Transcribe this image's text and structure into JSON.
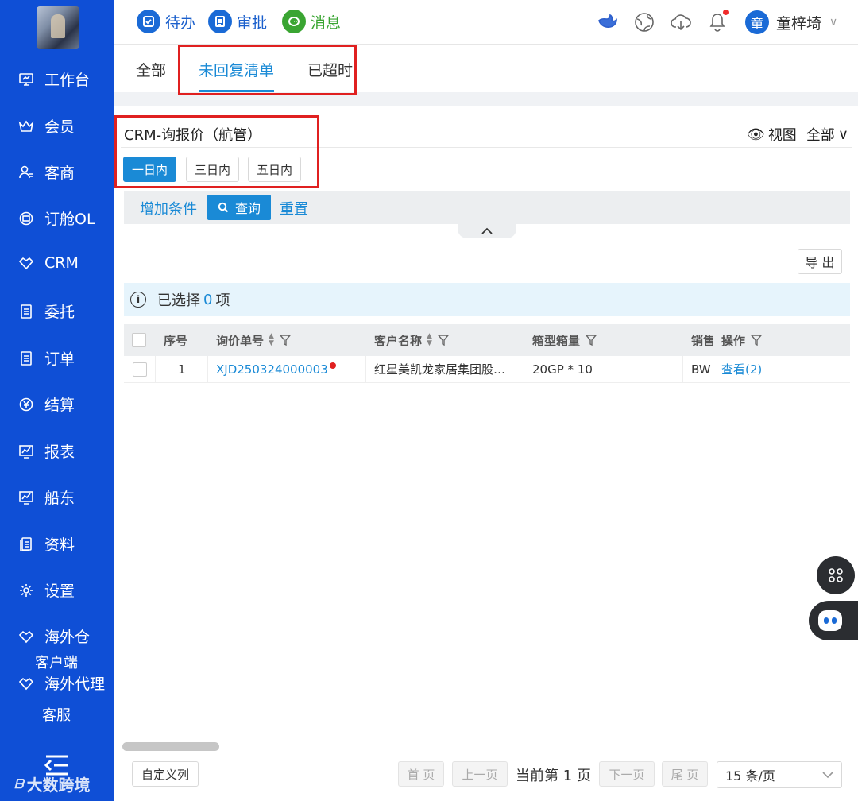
{
  "sidebar": {
    "items": [
      {
        "label": "工作台",
        "icon": "monitor-icon"
      },
      {
        "label": "会员",
        "icon": "crown-icon"
      },
      {
        "label": "客商",
        "icon": "user-group-icon"
      },
      {
        "label": "订舱OL",
        "icon": "booking-icon"
      },
      {
        "label": "CRM",
        "icon": "handshake-icon"
      },
      {
        "label": "委托",
        "icon": "document-icon"
      },
      {
        "label": "订单",
        "icon": "order-icon"
      },
      {
        "label": "结算",
        "icon": "currency-icon"
      },
      {
        "label": "报表",
        "icon": "chart-icon"
      },
      {
        "label": "船东",
        "icon": "ship-owner-icon"
      },
      {
        "label": "资料",
        "icon": "files-icon"
      },
      {
        "label": "设置",
        "icon": "gear-icon"
      },
      {
        "label": "海外仓",
        "icon": "warehouse-icon"
      },
      {
        "label": "海外代理",
        "icon": "agent-icon"
      }
    ],
    "sub_label_client": "客户端",
    "sub_label_service": "客服",
    "watermark": "大数跨境",
    "watermark_logo": "ᗷ"
  },
  "header": {
    "todo_label": "待办",
    "approval_label": "审批",
    "message_label": "消息",
    "user_avatar_char": "童",
    "user_name": "童梓埼"
  },
  "tabs": [
    {
      "label": "全部"
    },
    {
      "label": "未回复清单",
      "active": true
    },
    {
      "label": "已超时"
    }
  ],
  "panel": {
    "title": "CRM-询报价（航管）",
    "view_label": "视图",
    "view_value": "全部",
    "ranges": [
      "一日内",
      "三日内",
      "五日内"
    ],
    "add_condition": "增加条件",
    "query": "查询",
    "reset": "重置",
    "export": "导 出",
    "selected_prefix": "已选择",
    "selected_count": "0",
    "selected_suffix": "项"
  },
  "table": {
    "columns": [
      "序号",
      "询价单号",
      "客户名称",
      "箱型箱量",
      "销售",
      "操作"
    ],
    "rows": [
      {
        "index": "1",
        "inquiry_no": "XJD250324000003",
        "customer": "红星美凯龙家居集团股…",
        "container": "20GP * 10",
        "sales": "BW",
        "action": "查看(2)"
      }
    ]
  },
  "footer": {
    "custom_columns": "自定义列",
    "first": "首 页",
    "prev": "上一页",
    "current": "当前第 1 页",
    "next": "下一页",
    "last": "尾 页",
    "page_size": "15 条/页"
  },
  "colors": {
    "sidebar_bg": "#0f4fd6",
    "accent": "#1a8ad6",
    "highlight_box": "#e02020"
  }
}
